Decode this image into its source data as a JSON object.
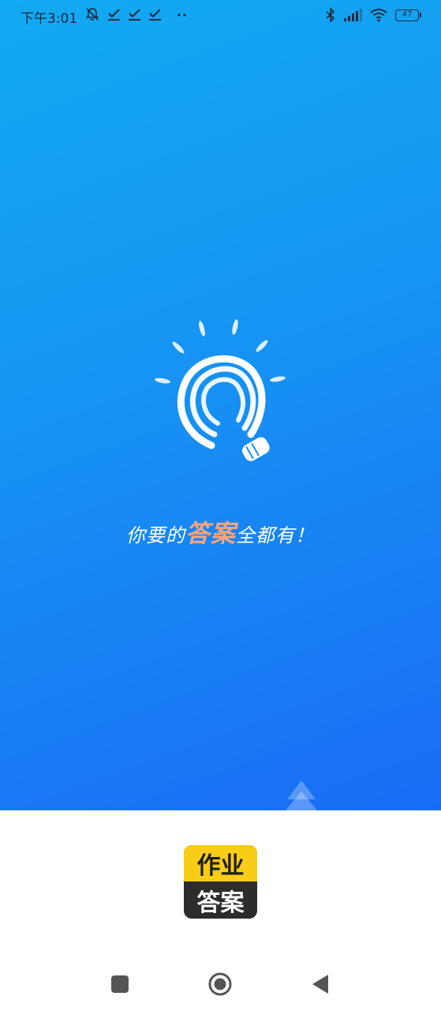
{
  "status_bar": {
    "time": "下午3:01",
    "battery_level": "47",
    "left_icons": [
      "notifications-off-icon",
      "check-icon",
      "check-icon",
      "check-icon",
      "more-dots-icon"
    ],
    "right_icons": [
      "bluetooth-icon",
      "signal-icon",
      "wifi-icon",
      "battery-icon"
    ]
  },
  "splash": {
    "tagline_before": "你要的",
    "tagline_highlight": "答案",
    "tagline_after": "全都有！",
    "colors": {
      "gradient_start": "#12aaf2",
      "gradient_end": "#1a6cf5",
      "highlight": "#f7a57f"
    }
  },
  "brand": {
    "top_text": "作业",
    "bottom_text": "答案",
    "colors": {
      "top_bg": "#f8cc17",
      "bottom_bg": "#2c2c2c"
    }
  },
  "nav": {
    "icons": [
      "recent-apps-icon",
      "home-icon",
      "back-icon"
    ]
  }
}
